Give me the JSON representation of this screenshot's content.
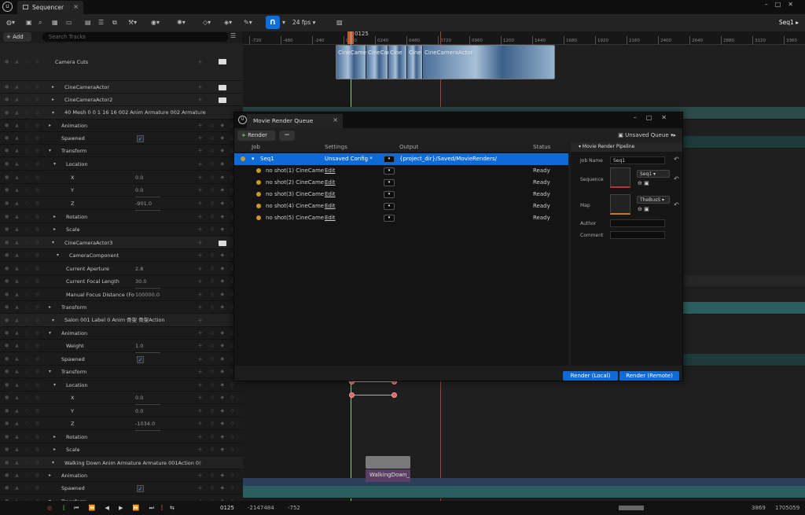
{
  "app": {
    "tab_title": "Sequencer",
    "sequence_name": "Seq1",
    "fps": "24 fps"
  },
  "left_header": {
    "add_label": "+ Add",
    "search_placeholder": "Search Tracks"
  },
  "tracks": [
    {
      "label": "Camera Cuts"
    },
    {
      "label": "CineCameraActor"
    },
    {
      "label": "CineCameraActor2"
    },
    {
      "label": "40 Mesh 0 0 1 16 16 002 Anim Armature 002 Armature"
    },
    {
      "label": "Animation"
    },
    {
      "label": "Spawned"
    },
    {
      "label": "Transform"
    },
    {
      "label": "Location"
    },
    {
      "label": "X",
      "value": "0.0"
    },
    {
      "label": "Y",
      "value": "0.0"
    },
    {
      "label": "Z",
      "value": "-901.0"
    },
    {
      "label": "Rotation"
    },
    {
      "label": "Scale"
    },
    {
      "label": "CineCameraActor3"
    },
    {
      "label": "CameraComponent"
    },
    {
      "label": "Current Aperture",
      "value": "2.8"
    },
    {
      "label": "Current Focal Length",
      "value": "30.0"
    },
    {
      "label": "Manual Focus Distance (Fo",
      "value": "100000.0"
    },
    {
      "label": "Transform"
    },
    {
      "label": "Salon 001 Label 0 Anim 骨架 骨架Action"
    },
    {
      "label": "Animation"
    },
    {
      "label": "Weight",
      "value": "1.0"
    },
    {
      "label": "Spawned"
    },
    {
      "label": "Transform"
    },
    {
      "label": "Location"
    },
    {
      "label": "X",
      "value": "0.0"
    },
    {
      "label": "Y",
      "value": "0.0"
    },
    {
      "label": "Z",
      "value": "-1034.0"
    },
    {
      "label": "Rotation"
    },
    {
      "label": "Scale"
    },
    {
      "label": "Walking Down Anim Armature Armature 001Action 0("
    },
    {
      "label": "Animation"
    },
    {
      "label": "Spawned"
    },
    {
      "label": "Transform"
    }
  ],
  "ruler": {
    "current_frame": "0125",
    "ticks": [
      "-720",
      "-480",
      "-240",
      "0000",
      "0240",
      "0480",
      "0720",
      "0960",
      "1200",
      "1440",
      "1680",
      "1920",
      "2160",
      "2400",
      "2640",
      "2880",
      "3120",
      "3360",
      "3600"
    ]
  },
  "camera_cuts_clips": [
    "CineCamera",
    "CineCam",
    "Cine",
    "Cine",
    "CineCameraActor"
  ],
  "clip_walking": "WalkingDown_",
  "mrq": {
    "title": "Movie Render Queue",
    "render_label": "Render",
    "minus_label": "−",
    "queue_label": "Unsaved Queue",
    "columns": {
      "job": "Job",
      "settings": "Settings",
      "output": "Output",
      "status": "Status"
    },
    "jobs": [
      {
        "job": "Seq1",
        "settings": "Unsaved Config *",
        "output": "{project_dir}/Saved/MovieRenders/",
        "status": ""
      },
      {
        "job": "no shot(1) CineCame",
        "settings": "Edit",
        "output": "",
        "status": "Ready"
      },
      {
        "job": "no shot(2) CineCame",
        "settings": "Edit",
        "output": "",
        "status": "Ready"
      },
      {
        "job": "no shot(3) CineCame",
        "settings": "Edit",
        "output": "",
        "status": "Ready"
      },
      {
        "job": "no shot(4) CineCame",
        "settings": "Edit",
        "output": "",
        "status": "Ready"
      },
      {
        "job": "no shot(5) CineCame",
        "settings": "Edit",
        "output": "",
        "status": "Ready"
      }
    ],
    "pipeline": {
      "header": "Movie Render Pipeline",
      "job_name_label": "Job Name",
      "job_name": "Seq1",
      "sequence_label": "Sequence",
      "sequence": "Seq1",
      "map_label": "Map",
      "map": "TheBusS",
      "author_label": "Author",
      "comment_label": "Comment"
    },
    "render_local": "Render (Local)",
    "render_remote": "Render (Remote)"
  },
  "bottom": {
    "frame": "0125",
    "left_range": "-2147484",
    "left_range2": "-752",
    "right_range": "3869",
    "right_range2": "1705059"
  }
}
